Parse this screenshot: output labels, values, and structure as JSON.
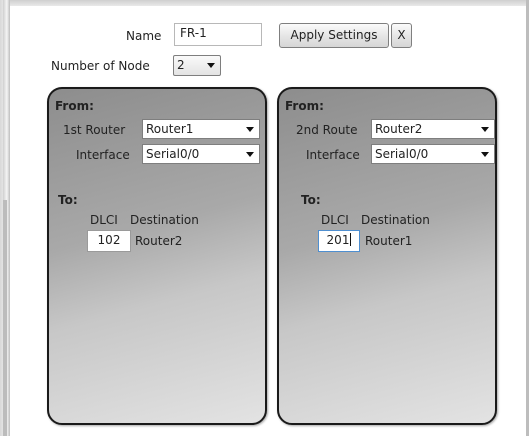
{
  "header": {
    "name_label": "Name",
    "name_value": "FR-1",
    "apply_label": "Apply Settings",
    "close_label": "X",
    "nodes_label": "Number of Node",
    "nodes_value": "2"
  },
  "panels": [
    {
      "from_label": "From:",
      "router_label": "1st Router",
      "router_value": "Router1",
      "interface_label": "Interface",
      "interface_value": "Serial0/0",
      "to_label": "To:",
      "dlci_label": "DLCI",
      "destination_label": "Destination",
      "dlci_value": "102",
      "destination_value": "Router2"
    },
    {
      "from_label": "From:",
      "router_label": "2nd Route",
      "router_value": "Router2",
      "interface_label": "Interface",
      "interface_value": "Serial0/0",
      "to_label": "To:",
      "dlci_label": "DLCI",
      "destination_label": "Destination",
      "dlci_value": "201",
      "destination_value": "Router1"
    }
  ]
}
